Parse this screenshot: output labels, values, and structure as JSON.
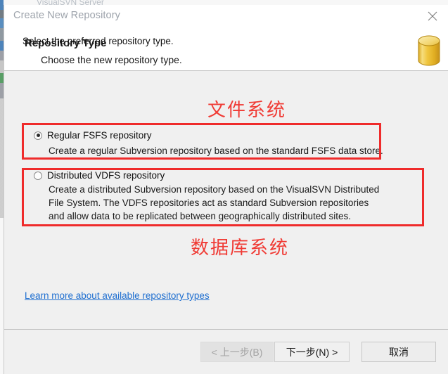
{
  "background_window": {
    "title": "VisualSVN Server"
  },
  "dialog": {
    "titlebar": {
      "title": "Create New Repository",
      "close_label": "close-icon"
    },
    "header": {
      "title": "Repository Type",
      "subtitle": "Choose the new repository type.",
      "icon": "database-cylinder-icon",
      "icon_color": "#e8b82e"
    },
    "body": {
      "select_label": "Select the preferred repository type.",
      "options": [
        {
          "id": "regular-fsfs",
          "title": "Regular FSFS repository",
          "description": "Create a regular Subversion repository based on the standard FSFS data store.",
          "selected": true
        },
        {
          "id": "distributed-vdfs",
          "title": "Distributed VDFS repository",
          "description": "Create a distributed Subversion repository based on the VisualSVN Distributed File System. The VDFS repositories act as standard Subversion repositories and allow data to be replicated between geographically distributed sites.",
          "selected": false
        }
      ],
      "link": {
        "label": "Learn more about available repository types",
        "color": "#1f6fd0"
      }
    },
    "annotations": {
      "color": "#ef2b2b",
      "note_top": "文件系统",
      "note_bottom": "数据库系统"
    },
    "footer": {
      "buttons": [
        {
          "id": "back",
          "label": "< 上一步(B)",
          "disabled": true
        },
        {
          "id": "next",
          "label": "下一步(N) >",
          "disabled": false
        },
        {
          "id": "cancel",
          "label": "取消",
          "disabled": false
        }
      ]
    }
  }
}
